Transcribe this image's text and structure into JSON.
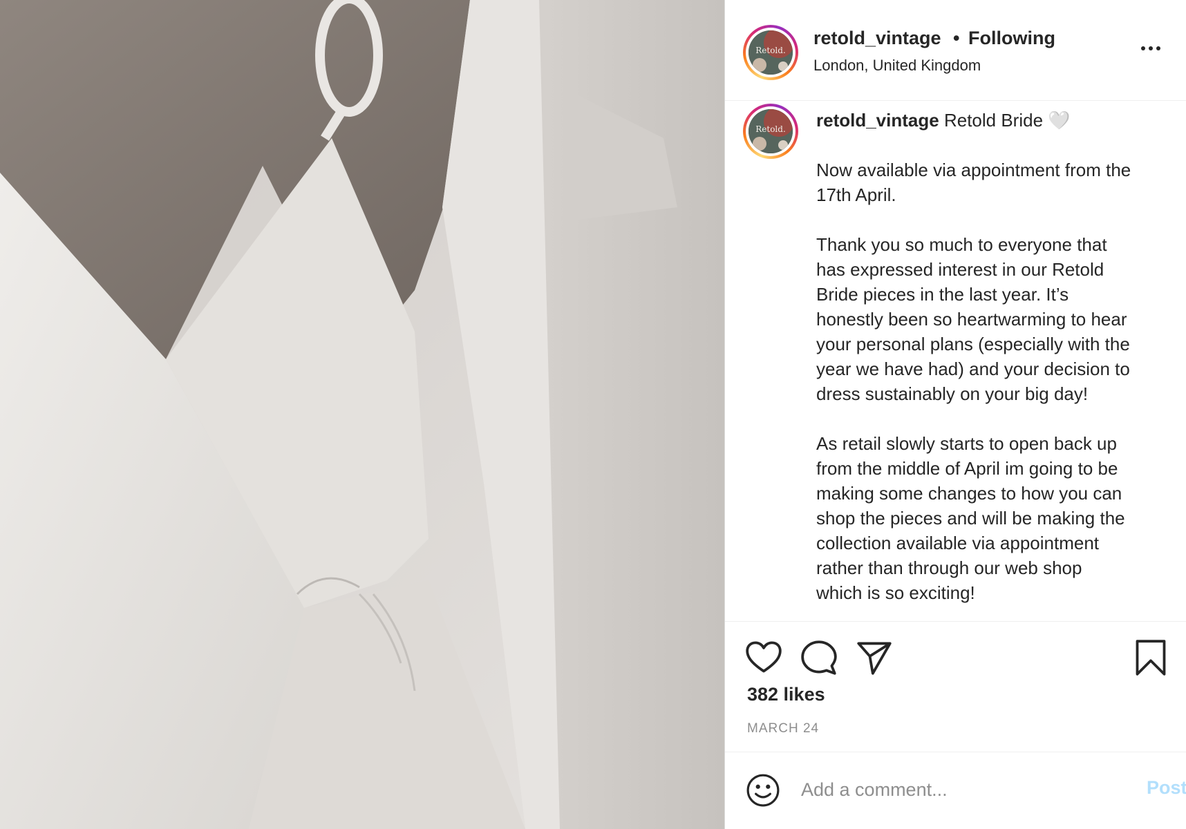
{
  "photo": {
    "description_icon": "photo-image"
  },
  "header": {
    "username": "retold_vintage",
    "separator": "•",
    "follow_status": "Following",
    "location": "London, United Kingdom",
    "avatar_text": "Retold.",
    "more_icon": "more-options-icon"
  },
  "caption": {
    "username": "retold_vintage",
    "avatar_text": "Retold.",
    "title": "Retold Bride 🤍",
    "paragraphs": [
      [
        "Now available via appointment from the",
        "17th April."
      ],
      [
        "Thank you so much to everyone that",
        "has expressed interest in our Retold",
        "Bride pieces in the last year. It’s",
        "honestly been so heartwarming to hear",
        "your personal plans (especially with the",
        "year we have had) and your decision to",
        "dress sustainably on your big day!"
      ],
      [
        "As retail slowly starts to open back up",
        "from the middle of April im going to be",
        "making some changes to how you can",
        "shop the pieces and will be making the",
        "collection available via appointment",
        "rather than through our web shop",
        "which is so exciting!"
      ]
    ]
  },
  "actions": {
    "like_icon": "heart-icon",
    "comment_icon": "comment-icon",
    "share_icon": "paper-plane-icon",
    "save_icon": "bookmark-icon"
  },
  "likes": "382 likes",
  "date": "MARCH 24",
  "comment": {
    "emoji_icon": "smiley-icon",
    "placeholder": "Add a comment...",
    "post_label": "Post"
  },
  "colors": {
    "text": "#262626",
    "muted": "#8e8e8e",
    "post_disabled": "#b2dffc",
    "divider": "#efefef"
  }
}
